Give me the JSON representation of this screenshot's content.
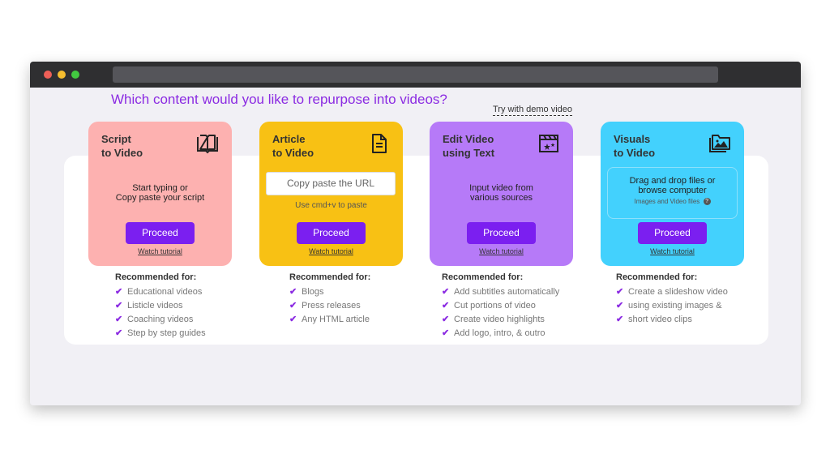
{
  "page": {
    "heading": "Which content would you like to repurpose into videos?",
    "demo_link": "Try with demo video"
  },
  "cards": {
    "script": {
      "title_line1": "Script",
      "title_line2": "to Video",
      "desc_line1": "Start typing or",
      "desc_line2": "Copy paste your script",
      "button": "Proceed",
      "tutorial": "Watch tutorial",
      "icon": "open-book-icon",
      "color": "#fdb1b0"
    },
    "article": {
      "title_line1": "Article",
      "title_line2": "to Video",
      "input_placeholder": "Copy paste the URL",
      "hint": "Use cmd+v to paste",
      "button": "Proceed",
      "tutorial": "Watch tutorial",
      "icon": "document-icon",
      "color": "#f8c114"
    },
    "edit": {
      "title_line1": "Edit Video",
      "title_line2": "using Text",
      "desc_line1": "Input video from",
      "desc_line2": "various sources",
      "button": "Proceed",
      "tutorial": "Watch tutorial",
      "icon": "clapperboard-icon",
      "color": "#b67af8"
    },
    "visuals": {
      "title_line1": "Visuals",
      "title_line2": "to Video",
      "drop_line1": "Drag and drop files or",
      "drop_line2": "browse computer",
      "drop_sub": "Images and Video files",
      "button": "Proceed",
      "tutorial": "Watch tutorial",
      "icon": "image-folder-icon",
      "color": "#43d1fd"
    }
  },
  "recommended": {
    "label": "Recommended for:",
    "script": [
      "Educational videos",
      "Listicle videos",
      "Coaching videos",
      "Step by step guides"
    ],
    "article": [
      "Blogs",
      "Press releases",
      "Any HTML article"
    ],
    "edit": [
      "Add subtitles automatically",
      "Cut portions of video",
      "Create video highlights",
      "Add logo, intro, & outro"
    ],
    "visuals": [
      "Create a slideshow video",
      "using existing images &",
      "short video clips"
    ]
  },
  "colors": {
    "accent": "#7b1ff0",
    "heading": "#8b2be2"
  }
}
